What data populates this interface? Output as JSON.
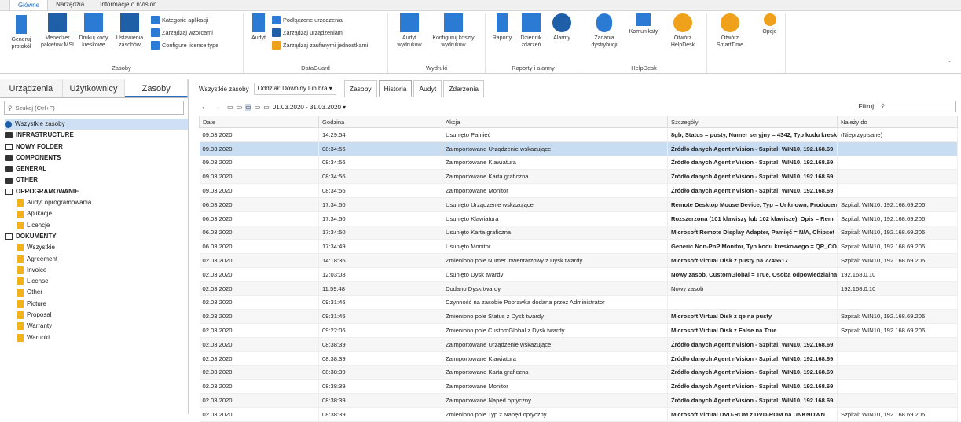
{
  "ribbon_tabs": [
    "Główne",
    "Narzędzia",
    "Informacje o nVision"
  ],
  "ribbon": {
    "zasoby": {
      "label": "Zasoby",
      "big": [
        "Generuj protokół",
        "Menedżer pakietów MSI",
        "Drukuj kody kreskowe",
        "Ustawienia zasobów"
      ],
      "small": [
        "Kategorie aplikacji",
        "Zarządzaj wzorcami",
        "Configure license type"
      ]
    },
    "dataguard": {
      "label": "DataGuard",
      "big": [
        "Audyt"
      ],
      "small": [
        "Podłączone urządzenia",
        "Zarządzaj urządzeniami",
        "Zarządzaj zaufanymi jednostkami"
      ]
    },
    "wydruki": {
      "label": "Wydruki",
      "big": [
        "Audyt wydruków",
        "Konfiguruj koszty wydruków"
      ]
    },
    "raporty": {
      "label": "Raporty i alarmy",
      "big": [
        "Raporty",
        "Dziennik zdarzeń",
        "Alarmy"
      ]
    },
    "helpdesk": {
      "label": "HelpDesk",
      "big": [
        "Zadania dystrybucji",
        "Komunikaty",
        "Otwórz HelpDesk"
      ]
    },
    "other": {
      "big": [
        "Otwórz SmartTime",
        "Opcje"
      ]
    }
  },
  "sidebar": {
    "tabs": [
      "Urządzenia",
      "Użytkownicy",
      "Zasoby"
    ],
    "search_placeholder": "Szukaj (Ctrl+F)",
    "tree": [
      {
        "label": "Wszystkie zasoby",
        "level": 0,
        "icon": "globe",
        "sel": true
      },
      {
        "label": "INFRASTRUCTURE",
        "level": 0,
        "icon": "folder",
        "bold": true
      },
      {
        "label": "NOWY FOLDER",
        "level": 0,
        "icon": "folder-open",
        "bold": true
      },
      {
        "label": "COMPONENTS",
        "level": 0,
        "icon": "folder",
        "bold": true
      },
      {
        "label": "GENERAL",
        "level": 0,
        "icon": "folder",
        "bold": true
      },
      {
        "label": "OTHER",
        "level": 0,
        "icon": "folder",
        "bold": true
      },
      {
        "label": "OPROGRAMOWANIE",
        "level": 0,
        "icon": "folder-open",
        "bold": true
      },
      {
        "label": "Audyt oprogramowania",
        "level": 1,
        "icon": "doc"
      },
      {
        "label": "Aplikacje",
        "level": 1,
        "icon": "doc"
      },
      {
        "label": "Licencje",
        "level": 1,
        "icon": "doc"
      },
      {
        "label": "DOKUMENTY",
        "level": 0,
        "icon": "folder-open",
        "bold": true
      },
      {
        "label": "Wszystkie",
        "level": 1,
        "icon": "doc"
      },
      {
        "label": "Agreement",
        "level": 1,
        "icon": "doc"
      },
      {
        "label": "Invoice",
        "level": 1,
        "icon": "doc"
      },
      {
        "label": "License",
        "level": 1,
        "icon": "doc"
      },
      {
        "label": "Other",
        "level": 1,
        "icon": "doc"
      },
      {
        "label": "Picture",
        "level": 1,
        "icon": "doc"
      },
      {
        "label": "Proposal",
        "level": 1,
        "icon": "doc"
      },
      {
        "label": "Warranty",
        "level": 1,
        "icon": "doc"
      },
      {
        "label": "Warunki",
        "level": 1,
        "icon": "doc"
      }
    ]
  },
  "main": {
    "label_all": "Wszystkie zasoby",
    "branch_select": "Oddział: Dowolny lub bra",
    "view_tabs": [
      "Zasoby",
      "Historia",
      "Audyt",
      "Zdarzenia"
    ],
    "date_range": "01.03.2020 - 31.03.2020",
    "filter_label": "Filtruj"
  },
  "table": {
    "headers": [
      "Date",
      "Godzina",
      "Akcja",
      "Szczegóły",
      "Należy do"
    ],
    "rows": [
      [
        "09.03.2020",
        "14:29:54",
        "Usunięto Pamięć",
        "8gb, Status = pusty, Numer seryjny = 4342, Typ kodu kresk",
        "(Nieprzypisane)"
      ],
      [
        "09.03.2020",
        "08:34:56",
        "Zaimportowane Urządzenie wskazujące",
        "Źródło danych Agent nVision - Szpital: WIN10, 192.168.69.",
        ""
      ],
      [
        "09.03.2020",
        "08:34:56",
        "Zaimportowane Klawiatura",
        "Źródło danych Agent nVision - Szpital: WIN10, 192.168.69.",
        ""
      ],
      [
        "09.03.2020",
        "08:34:56",
        "Zaimportowane Karta graficzna",
        "Źródło danych Agent nVision - Szpital: WIN10, 192.168.69.",
        ""
      ],
      [
        "09.03.2020",
        "08:34:56",
        "Zaimportowane Monitor",
        "Źródło danych Agent nVision - Szpital: WIN10, 192.168.69.",
        ""
      ],
      [
        "06.03.2020",
        "17:34:50",
        "Usunięto Urządzenie wskazujące",
        "Remote Desktop Mouse Device, Typ = Unknown, Producen",
        "Szpital: WIN10, 192.168.69.206"
      ],
      [
        "06.03.2020",
        "17:34:50",
        "Usunięto Klawiatura",
        "Rozszerzona (101 klawiszy lub 102 klawisze), Opis = Rem",
        "Szpital: WIN10, 192.168.69.206"
      ],
      [
        "06.03.2020",
        "17:34:50",
        "Usunięto Karta graficzna",
        "Microsoft Remote Display Adapter, Pamięć = N/A, Chipset",
        "Szpital: WIN10, 192.168.69.206"
      ],
      [
        "06.03.2020",
        "17:34:49",
        "Usunięto Monitor",
        "Generic Non-PnP Monitor, Typ kodu kreskowego = QR_COI",
        "Szpital: WIN10, 192.168.69.206"
      ],
      [
        "02.03.2020",
        "14:18:36",
        "Zmieniono pole Numer inwentarzowy z Dysk twardy",
        "Microsoft Virtual Disk z pusty na 7745617",
        "Szpital: WIN10, 192.168.69.206"
      ],
      [
        "02.03.2020",
        "12:03:08",
        "Usunięto Dysk twardy",
        "Nowy zasob, CustomGlobal = True, Osoba odpowiedzialna",
        "192.168.0.10"
      ],
      [
        "02.03.2020",
        "11:59:48",
        "Dodano Dysk twardy",
        "Nowy zasob",
        "192.168.0.10"
      ],
      [
        "02.03.2020",
        "09:31:46",
        "Czynność na zasobie Poprawka dodana przez Administrator",
        "",
        ""
      ],
      [
        "02.03.2020",
        "09:31:46",
        "Zmieniono pole Status z Dysk twardy",
        "Microsoft Virtual Disk z qe na pusty",
        "Szpital: WIN10, 192.168.69.206"
      ],
      [
        "02.03.2020",
        "09:22:06",
        "Zmieniono pole CustomGlobal z Dysk twardy",
        "Microsoft Virtual Disk z False na True",
        "Szpital: WIN10, 192.168.69.206"
      ],
      [
        "02.03.2020",
        "08:38:39",
        "Zaimportowane Urządzenie wskazujące",
        "Źródło danych Agent nVision - Szpital: WIN10, 192.168.69.",
        ""
      ],
      [
        "02.03.2020",
        "08:38:39",
        "Zaimportowane Klawiatura",
        "Źródło danych Agent nVision - Szpital: WIN10, 192.168.69.",
        ""
      ],
      [
        "02.03.2020",
        "08:38:39",
        "Zaimportowane Karta graficzna",
        "Źródło danych Agent nVision - Szpital: WIN10, 192.168.69.",
        ""
      ],
      [
        "02.03.2020",
        "08:38:39",
        "Zaimportowane Monitor",
        "Źródło danych Agent nVision - Szpital: WIN10, 192.168.69.",
        ""
      ],
      [
        "02.03.2020",
        "08:38:39",
        "Zaimportowane Napęd optyczny",
        "Źródło danych Agent nVision - Szpital: WIN10, 192.168.69.",
        ""
      ],
      [
        "02.03.2020",
        "08:38:39",
        "Zmieniono pole Typ z Napęd optyczny",
        "Microsoft Virtual DVD-ROM z DVD-ROM na UNKNOWN",
        "Szpital: WIN10, 192.168.69.206"
      ]
    ],
    "selected_row": 1
  }
}
